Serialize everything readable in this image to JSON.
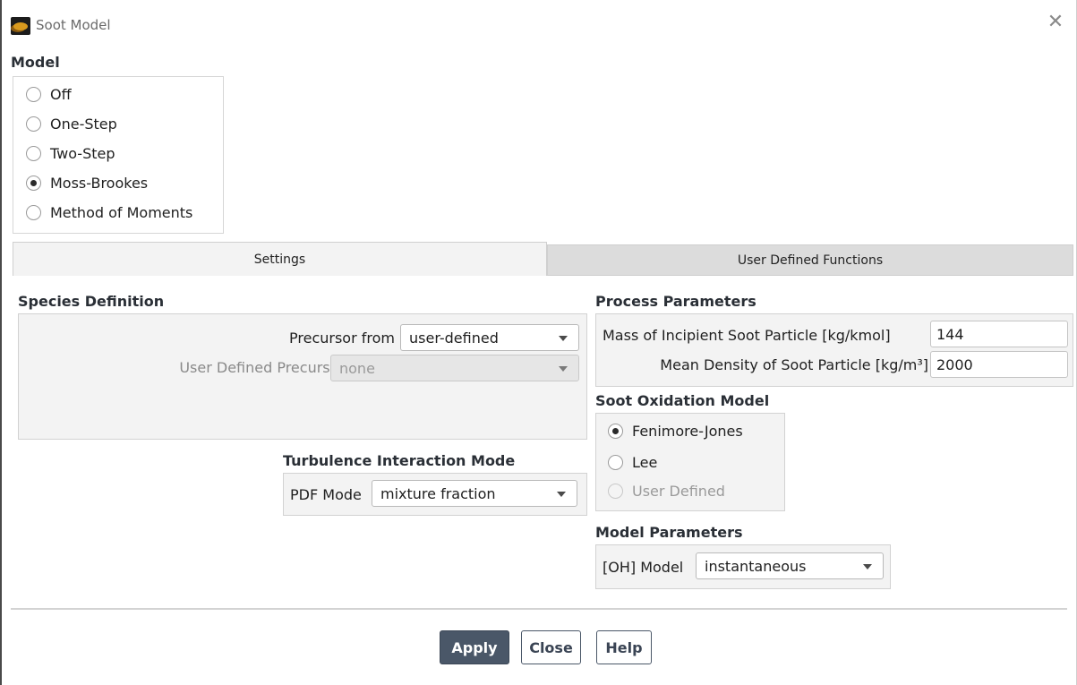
{
  "window": {
    "title": "Soot Model"
  },
  "model": {
    "label": "Model",
    "options": [
      "Off",
      "One-Step",
      "Two-Step",
      "Moss-Brookes",
      "Method of Moments"
    ],
    "selected": "Moss-Brookes"
  },
  "tabs": [
    {
      "label": "Settings",
      "active": true
    },
    {
      "label": "User Defined Functions",
      "active": false
    }
  ],
  "species": {
    "label": "Species Definition",
    "precursor_from_label": "Precursor from",
    "precursor_from_value": "user-defined",
    "udf_precursor_label": "User Defined Precursor",
    "udf_precursor_value": "none"
  },
  "turbulence": {
    "label": "Turbulence Interaction Mode",
    "pdf_mode_label": "PDF Mode",
    "pdf_mode_value": "mixture fraction"
  },
  "process": {
    "label": "Process Parameters",
    "mass_label": "Mass of Incipient Soot Particle [kg/kmol]",
    "mass_value": "144",
    "density_label": "Mean Density of Soot Particle [kg/m³]",
    "density_value": "2000"
  },
  "oxidation": {
    "label": "Soot Oxidation Model",
    "options": [
      "Fenimore-Jones",
      "Lee",
      "User Defined"
    ],
    "selected": "Fenimore-Jones",
    "disabled": [
      "User Defined"
    ]
  },
  "model_params": {
    "label": "Model Parameters",
    "oh_label": "[OH] Model",
    "oh_value": "instantaneous"
  },
  "buttons": {
    "apply": "Apply",
    "close": "Close",
    "help": "Help"
  },
  "colors": {
    "primary_button": "#4a5768",
    "panel_bg": "#f3f3f3"
  }
}
